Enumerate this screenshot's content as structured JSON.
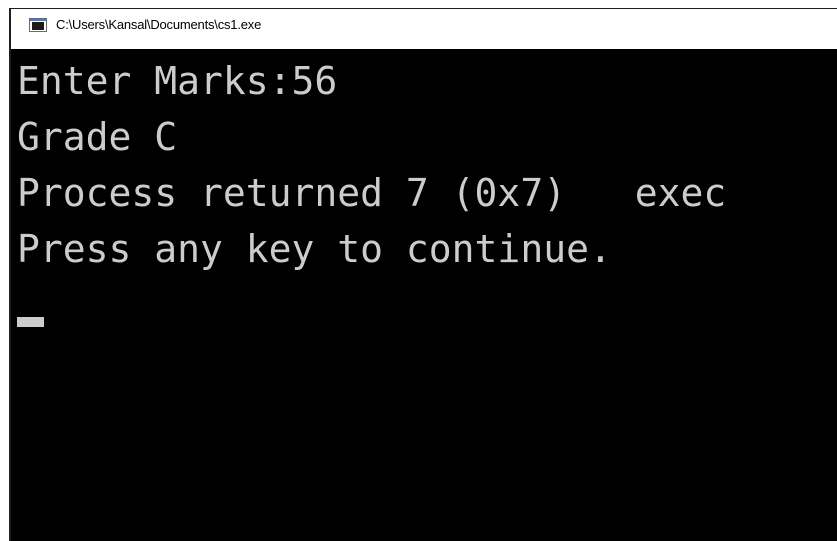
{
  "window": {
    "title": "C:\\Users\\Kansal\\Documents\\cs1.exe",
    "icon": "console-app-icon"
  },
  "console": {
    "lines": [
      "Enter Marks:56",
      "Grade C",
      "Process returned 7 (0x7)   exec",
      "Press any key to continue."
    ]
  },
  "colors": {
    "console_background": "#000000",
    "console_text": "#cccccc",
    "title_bar_background": "#ffffff",
    "title_text": "#000000"
  }
}
